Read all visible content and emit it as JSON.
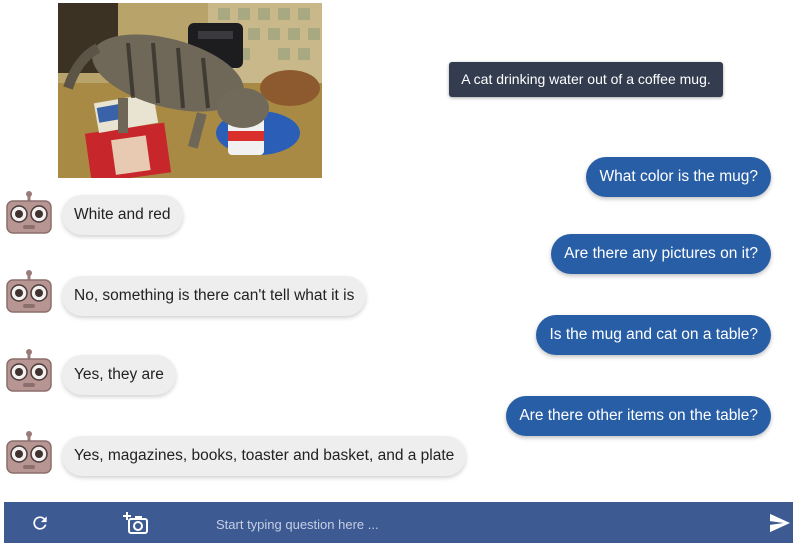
{
  "image": {
    "alt": ""
  },
  "caption": "A cat drinking water out of a coffee mug.",
  "conversation": [
    {
      "question": "What color is the mug?",
      "answer": "White and red"
    },
    {
      "question": "Are there any pictures on it?",
      "answer": "No, something is there can't tell what it is"
    },
    {
      "question": "Is the mug and cat on a table?",
      "answer": "Yes, they are"
    },
    {
      "question": "Are there other items on the table?",
      "answer": "Yes, magazines, books, toaster and basket, and a plate"
    }
  ],
  "input": {
    "placeholder": "Start typing question here ...",
    "value": ""
  },
  "icons": {
    "refresh": "refresh-icon",
    "add_photo": "add-photo-icon",
    "send": "send-icon",
    "bot": "robot-avatar-icon"
  },
  "colors": {
    "question_bubble": "#285ea6",
    "answer_bubble": "#eeeeee",
    "caption_bg": "#333d4f",
    "bottom_bar": "#3d5a92"
  }
}
